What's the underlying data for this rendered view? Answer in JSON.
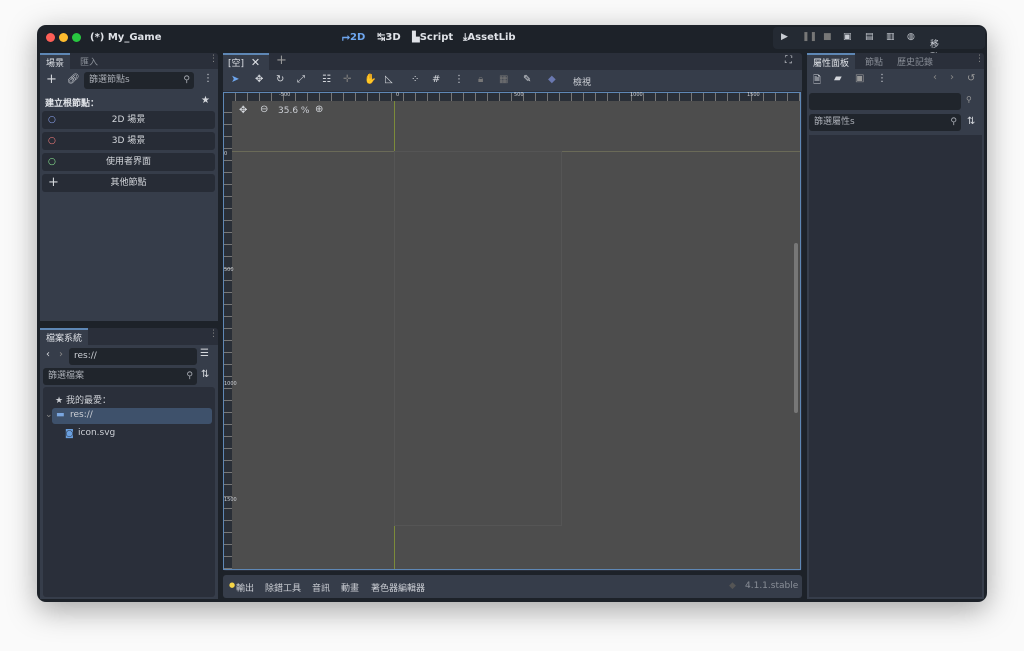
{
  "window": {
    "title": "(*) My_Game"
  },
  "modes": [
    {
      "label": "2D",
      "icon": "2d-icon",
      "active": true
    },
    {
      "label": "3D",
      "icon": "3d-icon"
    },
    {
      "label": "Script",
      "icon": "script-icon"
    },
    {
      "label": "AssetLib",
      "icon": "download-icon"
    }
  ],
  "run": {
    "device_label": "移動裝置"
  },
  "scene_dock": {
    "tabs": [
      "場景",
      "匯入"
    ],
    "filter_placeholder": "篩選節點s",
    "create_root_label": "建立根節點：",
    "nodes": [
      {
        "label": "2D 場景",
        "color": "#8da5f3"
      },
      {
        "label": "3D 場景",
        "color": "#fc7f7f"
      },
      {
        "label": "使用者界面",
        "color": "#8eef97"
      },
      {
        "label": "其他節點",
        "icon": "plus-icon"
      }
    ]
  },
  "fs_dock": {
    "tab": "檔案系統",
    "path": "res://",
    "filter_placeholder": "篩選檔案",
    "favorites_label": "我的最愛：",
    "tree": [
      {
        "label": "res://",
        "icon": "folder-icon",
        "selected": true
      },
      {
        "label": "icon.svg",
        "icon": "godot-icon"
      }
    ]
  },
  "editor": {
    "scene_tab": "[空]",
    "view_menu": "檢視",
    "zoom": "35.6 %",
    "ruler_h": [
      "-500",
      "0",
      "500",
      "1000",
      "1500"
    ],
    "ruler_v": [
      "0",
      "500",
      "1000",
      "1500"
    ]
  },
  "bottom": {
    "tabs": [
      "輸出",
      "除錯工具",
      "音訊",
      "動畫",
      "著色器編輯器"
    ],
    "version": "4.1.1.stable"
  },
  "inspector": {
    "tabs": [
      "屬性面板",
      "節點",
      "歷史記錄"
    ],
    "filter_placeholder": "篩選屬性s"
  },
  "colors": {
    "accent": "#5e87b5",
    "device": "#e0669b",
    "output_dot": "#f5d547"
  }
}
